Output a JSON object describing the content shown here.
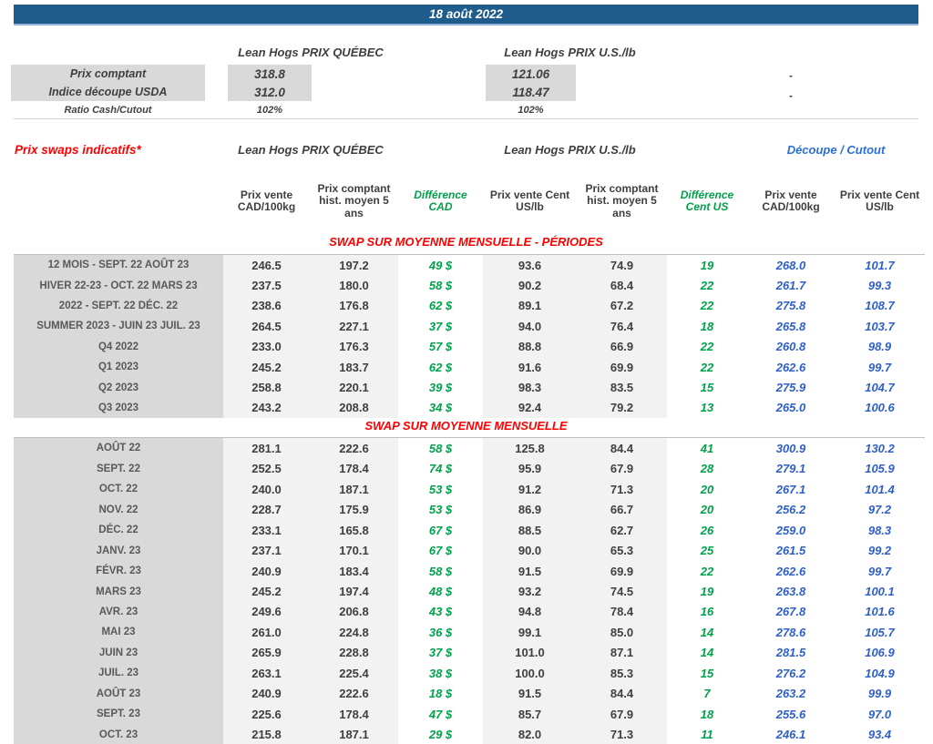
{
  "title_bar": {
    "date": "18 août 2022"
  },
  "spot": {
    "qc_header": "Lean Hogs PRIX QUÉBEC",
    "us_header": "Lean Hogs PRIX U.S./lb",
    "rows": [
      {
        "label": "Prix comptant",
        "qc": "318.8",
        "us": "121.06",
        "right": "-"
      },
      {
        "label": "Indice découpe USDA",
        "qc": "312.0",
        "us": "118.47",
        "right": "-"
      },
      {
        "label": "Ratio Cash/Cutout",
        "qc": "102%",
        "us": "102%",
        "right": ""
      }
    ]
  },
  "swaps": {
    "title": "Prix swaps indicatifs*",
    "qc_header": "Lean Hogs PRIX QUÉBEC",
    "us_header": "Lean Hogs PRIX U.S./lb",
    "cutout_header": "Découpe / Cutout",
    "columns": [
      "Prix vente CAD/100kg",
      "Prix comptant hist. moyen 5 ans",
      "Différence CAD",
      "Prix vente Cent US/lb",
      "Prix comptant hist. moyen 5 ans",
      "Différence Cent US",
      "Prix vente CAD/100kg",
      "Prix vente Cent US/lb"
    ],
    "sections": [
      {
        "title": "SWAP SUR MOYENNE MENSUELLE - PÉRIODES",
        "rows": [
          {
            "label": "12 MOIS - SEPT. 22 AOÛT 23",
            "values": [
              "246.5",
              "197.2",
              "49 $",
              "93.6",
              "74.9",
              "19",
              "268.0",
              "101.7"
            ]
          },
          {
            "label": "HIVER 22-23 - OCT. 22 MARS 23",
            "values": [
              "237.5",
              "180.0",
              "58 $",
              "90.2",
              "68.4",
              "22",
              "261.7",
              "99.3"
            ]
          },
          {
            "label": "2022 - SEPT. 22 DÉC. 22",
            "values": [
              "238.6",
              "176.8",
              "62 $",
              "89.1",
              "67.2",
              "22",
              "275.8",
              "108.7"
            ]
          },
          {
            "label": "SUMMER 2023 - JUIN 23 JUIL. 23",
            "values": [
              "264.5",
              "227.1",
              "37 $",
              "94.0",
              "76.4",
              "18",
              "265.8",
              "103.7"
            ]
          },
          {
            "label": "Q4 2022",
            "values": [
              "233.0",
              "176.3",
              "57 $",
              "88.8",
              "66.9",
              "22",
              "260.8",
              "98.9"
            ]
          },
          {
            "label": "Q1 2023",
            "values": [
              "245.2",
              "183.7",
              "62 $",
              "91.6",
              "69.9",
              "22",
              "262.6",
              "99.7"
            ]
          },
          {
            "label": "Q2 2023",
            "values": [
              "258.8",
              "220.1",
              "39 $",
              "98.3",
              "83.5",
              "15",
              "275.9",
              "104.7"
            ]
          },
          {
            "label": "Q3 2023",
            "values": [
              "243.2",
              "208.8",
              "34 $",
              "92.4",
              "79.2",
              "13",
              "265.0",
              "100.6"
            ]
          }
        ]
      },
      {
        "title": "SWAP SUR MOYENNE MENSUELLE",
        "rows": [
          {
            "label": "AOÛT 22",
            "values": [
              "281.1",
              "222.6",
              "58 $",
              "125.8",
              "84.4",
              "41",
              "300.9",
              "130.2"
            ]
          },
          {
            "label": "SEPT. 22",
            "values": [
              "252.5",
              "178.4",
              "74 $",
              "95.9",
              "67.9",
              "28",
              "279.1",
              "105.9"
            ]
          },
          {
            "label": "OCT. 22",
            "values": [
              "240.0",
              "187.1",
              "53 $",
              "91.2",
              "71.3",
              "20",
              "267.1",
              "101.4"
            ]
          },
          {
            "label": "NOV. 22",
            "values": [
              "228.7",
              "175.9",
              "53 $",
              "86.9",
              "66.7",
              "20",
              "256.2",
              "97.2"
            ]
          },
          {
            "label": "DÉC. 22",
            "values": [
              "233.1",
              "165.8",
              "67 $",
              "88.5",
              "62.7",
              "26",
              "259.0",
              "98.3"
            ]
          },
          {
            "label": "JANV. 23",
            "values": [
              "237.1",
              "170.1",
              "67 $",
              "90.0",
              "65.3",
              "25",
              "261.5",
              "99.2"
            ]
          },
          {
            "label": "FÉVR. 23",
            "values": [
              "240.9",
              "183.4",
              "58 $",
              "91.5",
              "69.9",
              "22",
              "262.6",
              "99.7"
            ]
          },
          {
            "label": "MARS 23",
            "values": [
              "245.2",
              "197.4",
              "48 $",
              "93.2",
              "74.5",
              "19",
              "263.8",
              "100.1"
            ]
          },
          {
            "label": "AVR. 23",
            "values": [
              "249.6",
              "206.8",
              "43 $",
              "94.8",
              "78.4",
              "16",
              "267.8",
              "101.6"
            ]
          },
          {
            "label": "MAI 23",
            "values": [
              "261.0",
              "224.8",
              "36 $",
              "99.1",
              "85.0",
              "14",
              "278.6",
              "105.7"
            ]
          },
          {
            "label": "JUIN 23",
            "values": [
              "265.9",
              "228.8",
              "37 $",
              "101.0",
              "87.1",
              "14",
              "281.5",
              "106.9"
            ]
          },
          {
            "label": "JUIL. 23",
            "values": [
              "263.1",
              "225.4",
              "38 $",
              "100.0",
              "85.3",
              "15",
              "276.2",
              "104.9"
            ]
          },
          {
            "label": "AOÛT 23",
            "values": [
              "240.9",
              "222.6",
              "18 $",
              "91.5",
              "84.4",
              "7",
              "263.2",
              "99.9"
            ]
          },
          {
            "label": "SEPT. 23",
            "values": [
              "225.6",
              "178.4",
              "47 $",
              "85.7",
              "67.9",
              "18",
              "255.6",
              "97.0"
            ]
          },
          {
            "label": "OCT. 23",
            "values": [
              "215.8",
              "187.1",
              "29 $",
              "82.0",
              "71.3",
              "11",
              "246.1",
              "93.4"
            ]
          }
        ]
      }
    ]
  },
  "colors": {
    "banner_navy": "#1F5C8C",
    "accent_red": "#FF0000",
    "accent_green": "#00A14B",
    "accent_blue": "#2F5FC8",
    "cutout_blue": "#2B6FD4",
    "label_gray_bg": "#D9D9D9",
    "band_gray_bg": "#F2F2F2",
    "text_dark": "#3F3F3F"
  }
}
